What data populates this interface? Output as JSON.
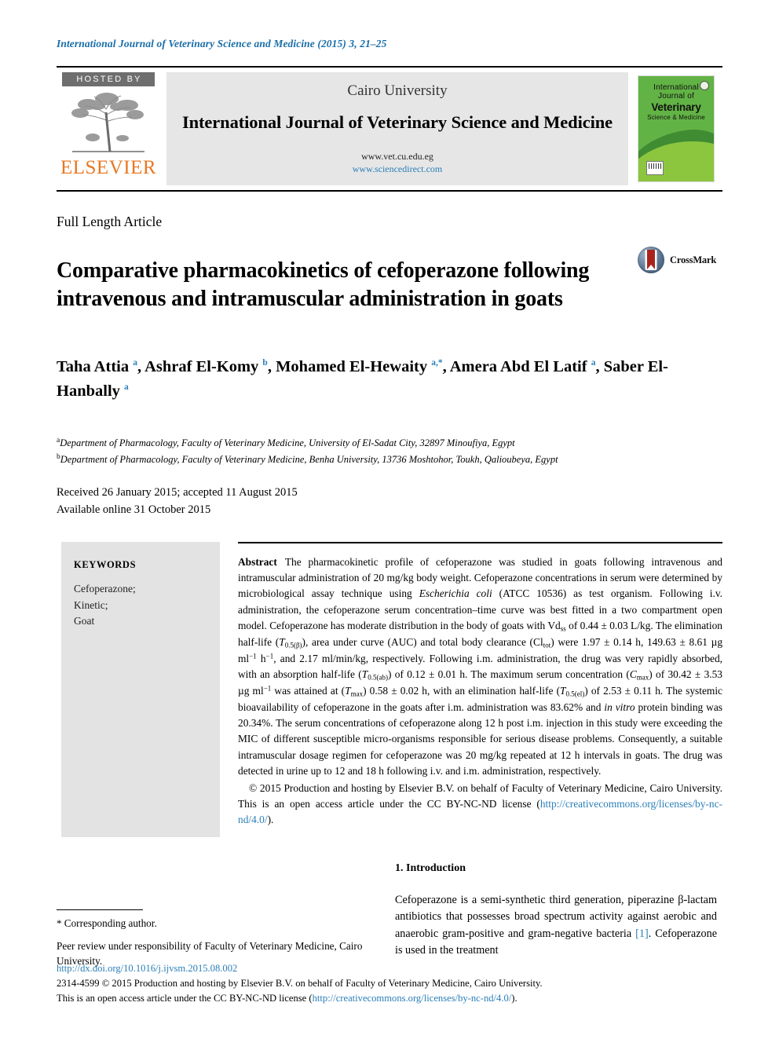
{
  "running_head": "International Journal of Veterinary Science and Medicine (2015) 3, 21–25",
  "masthead": {
    "hosted_by": "HOSTED BY",
    "publisher": "ELSEVIER",
    "tree_logo_icon": "elsevier-tree-icon",
    "university": "Cairo University",
    "journal_title": "International Journal of Veterinary Science and Medicine",
    "url_primary": "www.vet.cu.edu.eg",
    "url_secondary": "www.sciencedirect.com",
    "cover": {
      "line1": "International",
      "line2": "Journal of",
      "line3": "Veterinary",
      "line4": "Science & Medicine"
    }
  },
  "article_type": "Full Length Article",
  "title": "Comparative pharmacokinetics of cefoperazone following intravenous and intramuscular administration in goats",
  "crossmark_label": "CrossMark",
  "authors_html": "Taha Attia <sup>a</sup>, Ashraf El-Komy <sup>b</sup>, Mohamed El-Hewaity <sup>a,*</sup>, Amera Abd El Latif <sup>a</sup>, Saber El-Hanbally <sup>a</sup>",
  "affiliations": [
    "a Department of Pharmacology, Faculty of Veterinary Medicine, University of El-Sadat City, 32897 Minoufiya, Egypt",
    "b Department of Pharmacology, Faculty of Veterinary Medicine, Benha University, 13736 Moshtohor, Toukh, Qalioubeya, Egypt"
  ],
  "history": {
    "received_accepted": "Received 26 January 2015; accepted 11 August 2015",
    "available_online": "Available online 31 October 2015"
  },
  "keywords": {
    "heading": "KEYWORDS",
    "items": [
      "Cefoperazone;",
      "Kinetic;",
      "Goat"
    ]
  },
  "abstract": {
    "label": "Abstract",
    "body_html": "The pharmacokinetic profile of cefoperazone was studied in goats following intravenous and intramuscular administration of 20 mg/kg body weight. Cefoperazone concentrations in serum were determined by microbiological assay technique using <i>Escherichia coli</i> (ATCC 10536) as test organism. Following i.v. administration, the cefoperazone serum concentration–time curve was best fitted in a two compartment open model. Cefoperazone has moderate distribution in the body of goats with Vd<sub>ss</sub> of 0.44 ± 0.03 L/kg. The elimination half-life (<i>T</i><sub>0.5(β)</sub>), area under curve (AUC) and total body clearance (Cl<sub>tot</sub>) were 1.97 ± 0.14 h, 149.63 ± 8.61 µg ml<sup>−1</sup> h<sup>−1</sup>, and 2.17 ml/min/kg, respectively. Following i.m. administration, the drug was very rapidly absorbed, with an absorption half-life (<i>T</i><sub>0.5(ab)</sub>) of 0.12 ± 0.01 h. The maximum serum concentration (<i>C</i><sub>max</sub>) of 30.42 ± 3.53 µg ml<sup>−1</sup> was attained at (<i>T</i><sub>max</sub>) 0.58 ± 0.02 h, with an elimination half-life (<i>T</i><sub>0.5(el)</sub>) of 2.53 ± 0.11 h. The systemic bioavailability of cefoperazone in the goats after i.m. administration was 83.62% and <i>in vitro</i> protein binding was 20.34%. The serum concentrations of cefoperazone along 12 h post i.m. injection in this study were exceeding the MIC of different susceptible micro-organisms responsible for serious disease problems. Consequently, a suitable intramuscular dosage regimen for cefoperazone was 20 mg/kg repeated at 12 h intervals in goats. The drug was detected in urine up to 12 and 18 h following i.v. and i.m. administration, respectively.",
    "copyright_html": "© 2015 Production and hosting by Elsevier B.V. on behalf of Faculty of Veterinary Medicine, Cairo University. This is an open access article under the CC BY-NC-ND license (<span class=\"lnk\">http://creativecommons.org/licenses/by-nc-nd/4.0/</span>)."
  },
  "introduction": {
    "heading": "1. Introduction",
    "body_html": "Cefoperazone is a semi-synthetic third generation, piperazine β-lactam antibiotics that possesses broad spectrum activity against aerobic and anaerobic gram-positive and gram-negative bacteria <span class=\"lnk\">[1]</span>. Cefoperazone is used in the treatment"
  },
  "footnote": {
    "corresponding": "Corresponding author.",
    "peer_review": "Peer review under responsibility of Faculty of Veterinary Medicine, Cairo University."
  },
  "bottom": {
    "doi": "http://dx.doi.org/10.1016/j.ijvsm.2015.08.002",
    "line2": "2314-4599 © 2015 Production and hosting by Elsevier B.V. on behalf of Faculty of Veterinary Medicine, Cairo University.",
    "line3_html": "This is an open access article under the CC BY-NC-ND license (<span class=\"lnk\">http://creativecommons.org/licenses/by-nc-nd/4.0/</span>)."
  },
  "colors": {
    "link_blue": "#2b7fb8",
    "elsevier_orange": "#E87722",
    "cover_green": "#62b345",
    "keyword_box_gray": "#e3e3e3",
    "hosted_gray": "#6e6e6e"
  }
}
